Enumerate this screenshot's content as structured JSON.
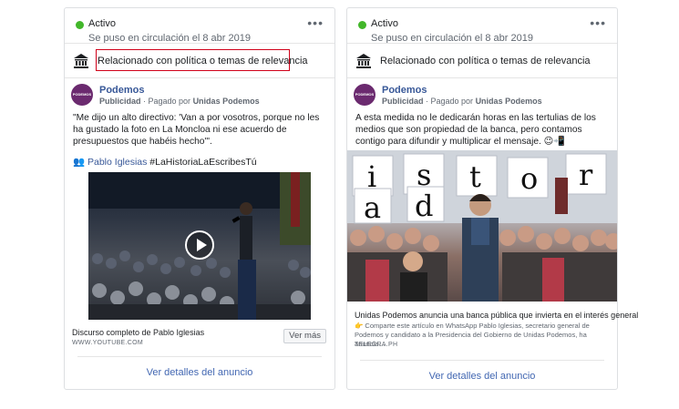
{
  "cards": [
    {
      "status": "Activo",
      "date": "Se puso en circulación el 8 abr 2019",
      "more": "•••",
      "topic": "Relacionado con política o temas de relevancia",
      "topic_highlighted": true,
      "advertiser": {
        "avatar_text": "PODEMOS",
        "name": "Podemos",
        "sub_label": "Publicidad",
        "paid_by": " · Pagado por ",
        "payer": "Unidas Podemos"
      },
      "text": "\"Me dijo un alto directivo: 'Van a por vosotros, porque no les ha gustado la foto en La Moncloa ni ese acuerdo de presupuestos que habéis hecho'\".",
      "hashtag_emoji": "👥",
      "mention": "Pablo Iglesias",
      "hashtag": " #LaHistoriaLaEscribesTú",
      "media_type": "video",
      "link": {
        "title": "Discurso completo de Pablo Iglesias",
        "domain": "WWW.YOUTUBE.COM",
        "button": "Ver más"
      },
      "details": "Ver detalles del anuncio"
    },
    {
      "status": "Activo",
      "date": "Se puso en circulación el 8 abr 2019",
      "more": "•••",
      "topic": "Relacionado con política o temas de relevancia",
      "topic_highlighted": false,
      "advertiser": {
        "avatar_text": "PODEMOS",
        "name": "Podemos",
        "sub_label": "Publicidad",
        "paid_by": " · Pagado por ",
        "payer": "Unidas Podemos"
      },
      "text": "A esta medida no le dedicarán horas en las tertulias de los medios que son propiedad de la banca, pero contamos contigo para difundir y multiplicar el mensaje. 😉📲",
      "media_type": "photo",
      "photo_letters": [
        "i",
        "s",
        "t",
        "o",
        "r",
        "d",
        "a"
      ],
      "link": {
        "title": "Unidas Podemos anuncia una banca pública que invierta en el interés general",
        "description": "👉 Comparte este artículo en WhatsApp Pablo Iglesias, secretario general de Podemos y candidato a la Presidencia del Gobierno de Unidas Podemos, ha anuncia…",
        "domain": "TELEGRA.PH"
      },
      "details": "Ver detalles del anuncio"
    }
  ],
  "colors": {
    "active": "#42b72a",
    "link": "#385898",
    "highlight_border": "#d0021b",
    "avatar": "#6b2a6f"
  }
}
